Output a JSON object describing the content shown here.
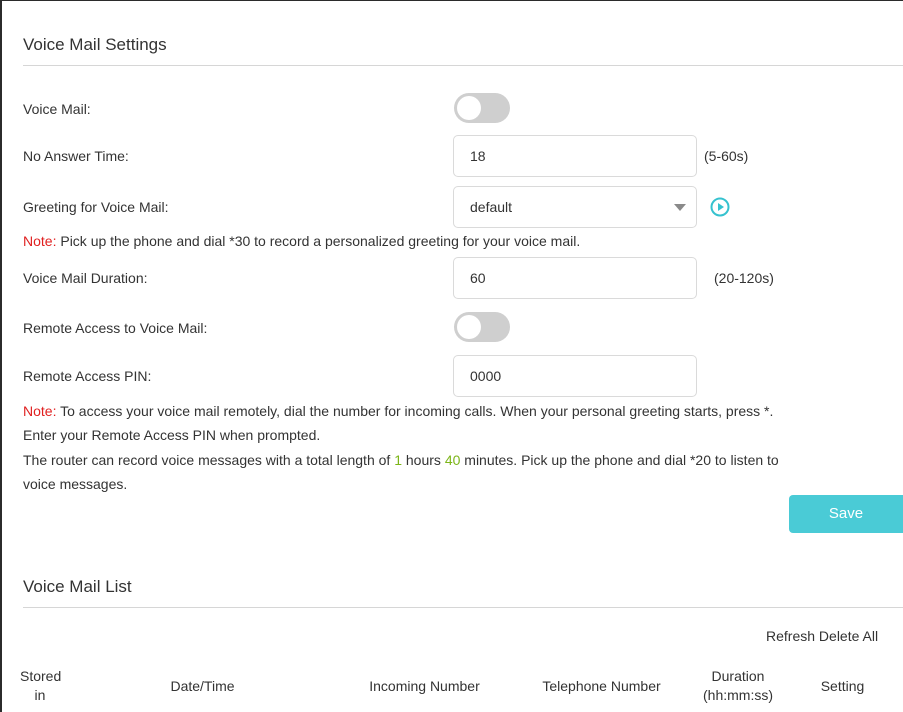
{
  "voicemail_settings": {
    "title": "Voice Mail Settings",
    "voice_mail": {
      "label": "Voice Mail:",
      "enabled": false
    },
    "no_answer_time": {
      "label": "No Answer Time:",
      "value": "18",
      "hint": "(5-60s)"
    },
    "greeting": {
      "label": "Greeting for Voice Mail:",
      "selected": "default",
      "play_icon": "play-circle-icon"
    },
    "note1_prefix": "Note:",
    "note1_text": " Pick up the phone and dial *30 to record a personalized greeting for your voice mail.",
    "duration": {
      "label": "Voice Mail Duration:",
      "value": "60",
      "hint": "(20-120s)"
    },
    "remote_access": {
      "label": "Remote Access to Voice Mail:",
      "enabled": false
    },
    "remote_pin": {
      "label": "Remote Access PIN:",
      "value": "0000"
    },
    "note2_prefix": "Note:",
    "note2_line1": " To access your voice mail remotely, dial the number for incoming calls. When your personal greeting starts, press *.",
    "note2_line2": "Enter your Remote Access PIN when prompted.",
    "info_part1": "The router can record voice messages with a total length of ",
    "info_hours": "1",
    "info_part2": " hours ",
    "info_minutes": "40",
    "info_part3": " minutes. Pick up the phone and dial *20 to listen to",
    "info_line2": "voice messages.",
    "save_label": "Save"
  },
  "voicemail_list": {
    "title": "Voice Mail List",
    "refresh_label": "Refresh",
    "delete_all_label": "Delete All",
    "columns": [
      "Stored in",
      "Date/Time",
      "Incoming Number",
      "Telephone Number",
      "Duration (hh:mm:ss)",
      "Setting"
    ]
  },
  "colors": {
    "accent": "#4acbd6",
    "note_red": "#e02020",
    "value_green": "#7cb518",
    "toggle_off": "#cfcfcf"
  }
}
